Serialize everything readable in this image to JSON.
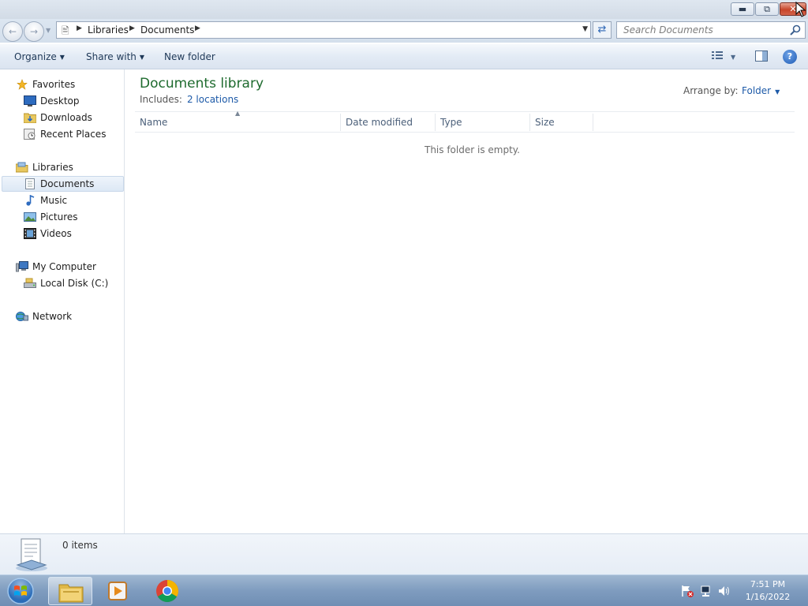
{
  "window": {
    "caption_buttons": {
      "minimize_icon": "minimize-icon",
      "restore_icon": "restore-icon",
      "close_icon": "close-icon"
    }
  },
  "address": {
    "breadcrumbs": [
      "Libraries",
      "Documents"
    ],
    "search_placeholder": "Search Documents"
  },
  "toolbar": {
    "organize_label": "Organize",
    "share_label": "Share with",
    "new_folder_label": "New folder"
  },
  "nav": {
    "favorites": {
      "label": "Favorites",
      "items": [
        "Desktop",
        "Downloads",
        "Recent Places"
      ]
    },
    "libraries": {
      "label": "Libraries",
      "items": [
        "Documents",
        "Music",
        "Pictures",
        "Videos"
      ],
      "selected": "Documents"
    },
    "computer": {
      "label": "My Computer",
      "items": [
        "Local Disk (C:)"
      ]
    },
    "network": {
      "label": "Network"
    }
  },
  "main": {
    "title": "Documents library",
    "includes_label": "Includes:",
    "includes_link": "2 locations",
    "arrange_label": "Arrange by:",
    "arrange_value": "Folder",
    "columns": [
      "Name",
      "Date modified",
      "Type",
      "Size"
    ],
    "empty_message": "This folder is empty."
  },
  "details": {
    "count": "0 items"
  },
  "taskbar": {
    "time": "7:51 PM",
    "date": "1/16/2022",
    "pinned": [
      "windows-explorer-icon",
      "media-player-icon",
      "chrome-icon"
    ]
  },
  "colors": {
    "title_green": "#1e6b2e",
    "link_blue": "#1d5aa8",
    "close_red": "#c7452a"
  }
}
